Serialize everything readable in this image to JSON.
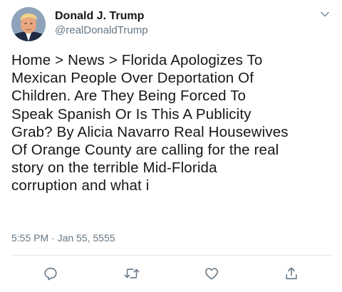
{
  "user": {
    "display_name": "Donald J. Trump",
    "handle": "@realDonaldTrump",
    "avatar": "profile-photo"
  },
  "tweet": {
    "text": "Home > News > Florida Apologizes To\nMexican People Over Deportation Of\nChildren. Are They Being Forced To\nSpeak Spanish Or Is This A Publicity\nGrab? By Alicia Navarro Real Housewives\nOf Orange County are calling for the real\nstory on the terrible Mid-Florida\ncorruption and what i",
    "timestamp": "5:55 PM · Jan 55, 5555"
  },
  "actions": [
    {
      "name": "reply",
      "icon": "reply-icon"
    },
    {
      "name": "retweet",
      "icon": "retweet-icon"
    },
    {
      "name": "like",
      "icon": "heart-icon"
    },
    {
      "name": "share",
      "icon": "share-icon"
    }
  ],
  "colors": {
    "text": "#14171a",
    "secondary": "#657786",
    "divider": "#e1e8ed"
  }
}
